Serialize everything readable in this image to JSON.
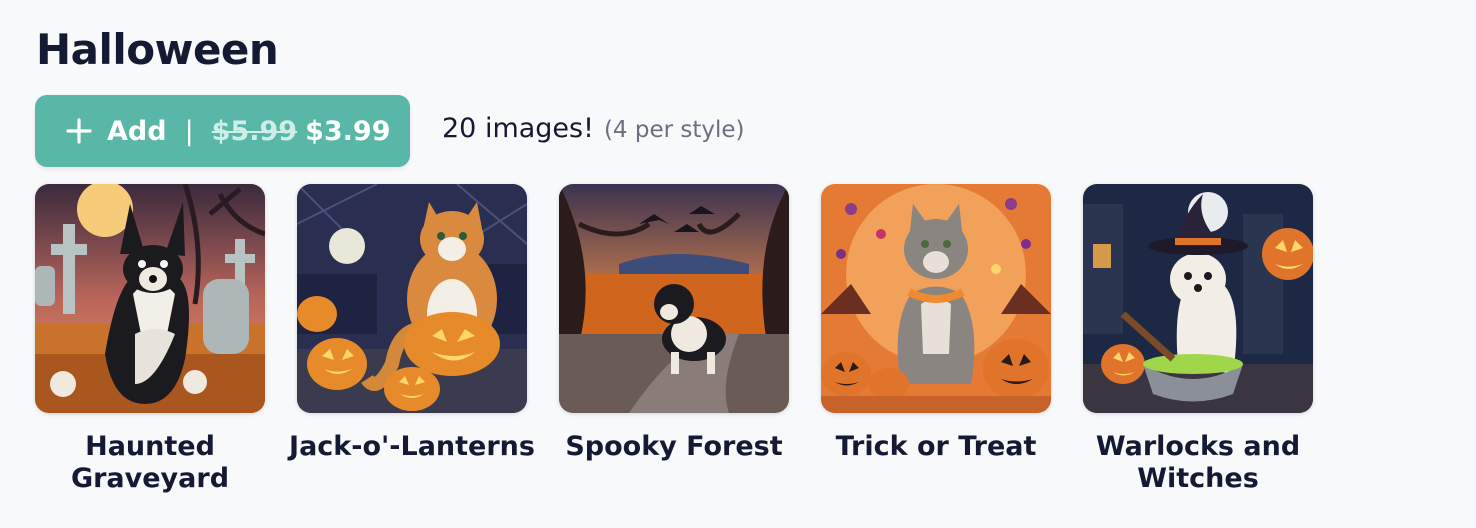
{
  "section": {
    "title": "Halloween",
    "add_button": {
      "label": "Add",
      "separator": "|",
      "old_price": "$5.99",
      "new_price": "$3.99",
      "accent_color": "#58b7a6"
    },
    "image_count": "20 images!",
    "image_note": "(4 per style)"
  },
  "styles": [
    {
      "label": "Haunted Graveyard",
      "icon": "dog-graveyard-image"
    },
    {
      "label": "Jack-o'-Lanterns",
      "icon": "cat-pumpkins-image"
    },
    {
      "label": "Spooky Forest",
      "icon": "dog-forest-image"
    },
    {
      "label": "Trick or Treat",
      "icon": "cat-candy-image"
    },
    {
      "label": "Warlocks and Witches",
      "icon": "dog-witch-image"
    }
  ]
}
